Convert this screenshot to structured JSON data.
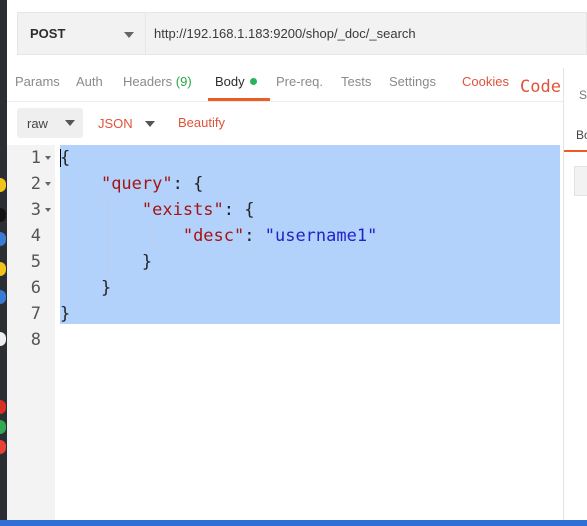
{
  "request": {
    "method": "POST",
    "url": "http://192.168.1.183:9200/shop/_doc/_search"
  },
  "tabs": [
    {
      "label": "Params"
    },
    {
      "label": "Auth"
    },
    {
      "label": "Headers",
      "count": "(9)"
    },
    {
      "label": "Body",
      "active": true
    },
    {
      "label": "Pre-req."
    },
    {
      "label": "Tests"
    },
    {
      "label": "Settings"
    }
  ],
  "tab_links": {
    "cookies": "Cookies",
    "code": "Code"
  },
  "right_pane": {
    "tab1": "Sta",
    "tab2": "Bo"
  },
  "body_options": {
    "mode": "raw",
    "format": "JSON",
    "beautify": "Beautify"
  },
  "editor": {
    "line_numbers": [
      "1",
      "2",
      "3",
      "4",
      "5",
      "6",
      "7",
      "8"
    ],
    "lines": [
      "{",
      "    \"query\": {",
      "        \"exists\": {",
      "            \"desc\": \"username1\"",
      "        }",
      "    }",
      "}",
      ""
    ]
  },
  "colors": {
    "accent": "#ef5b25",
    "selection": "#b3d2fb",
    "json_key": "#a31515",
    "json_string": "#2222c9",
    "body_dot": "#29b35a"
  }
}
